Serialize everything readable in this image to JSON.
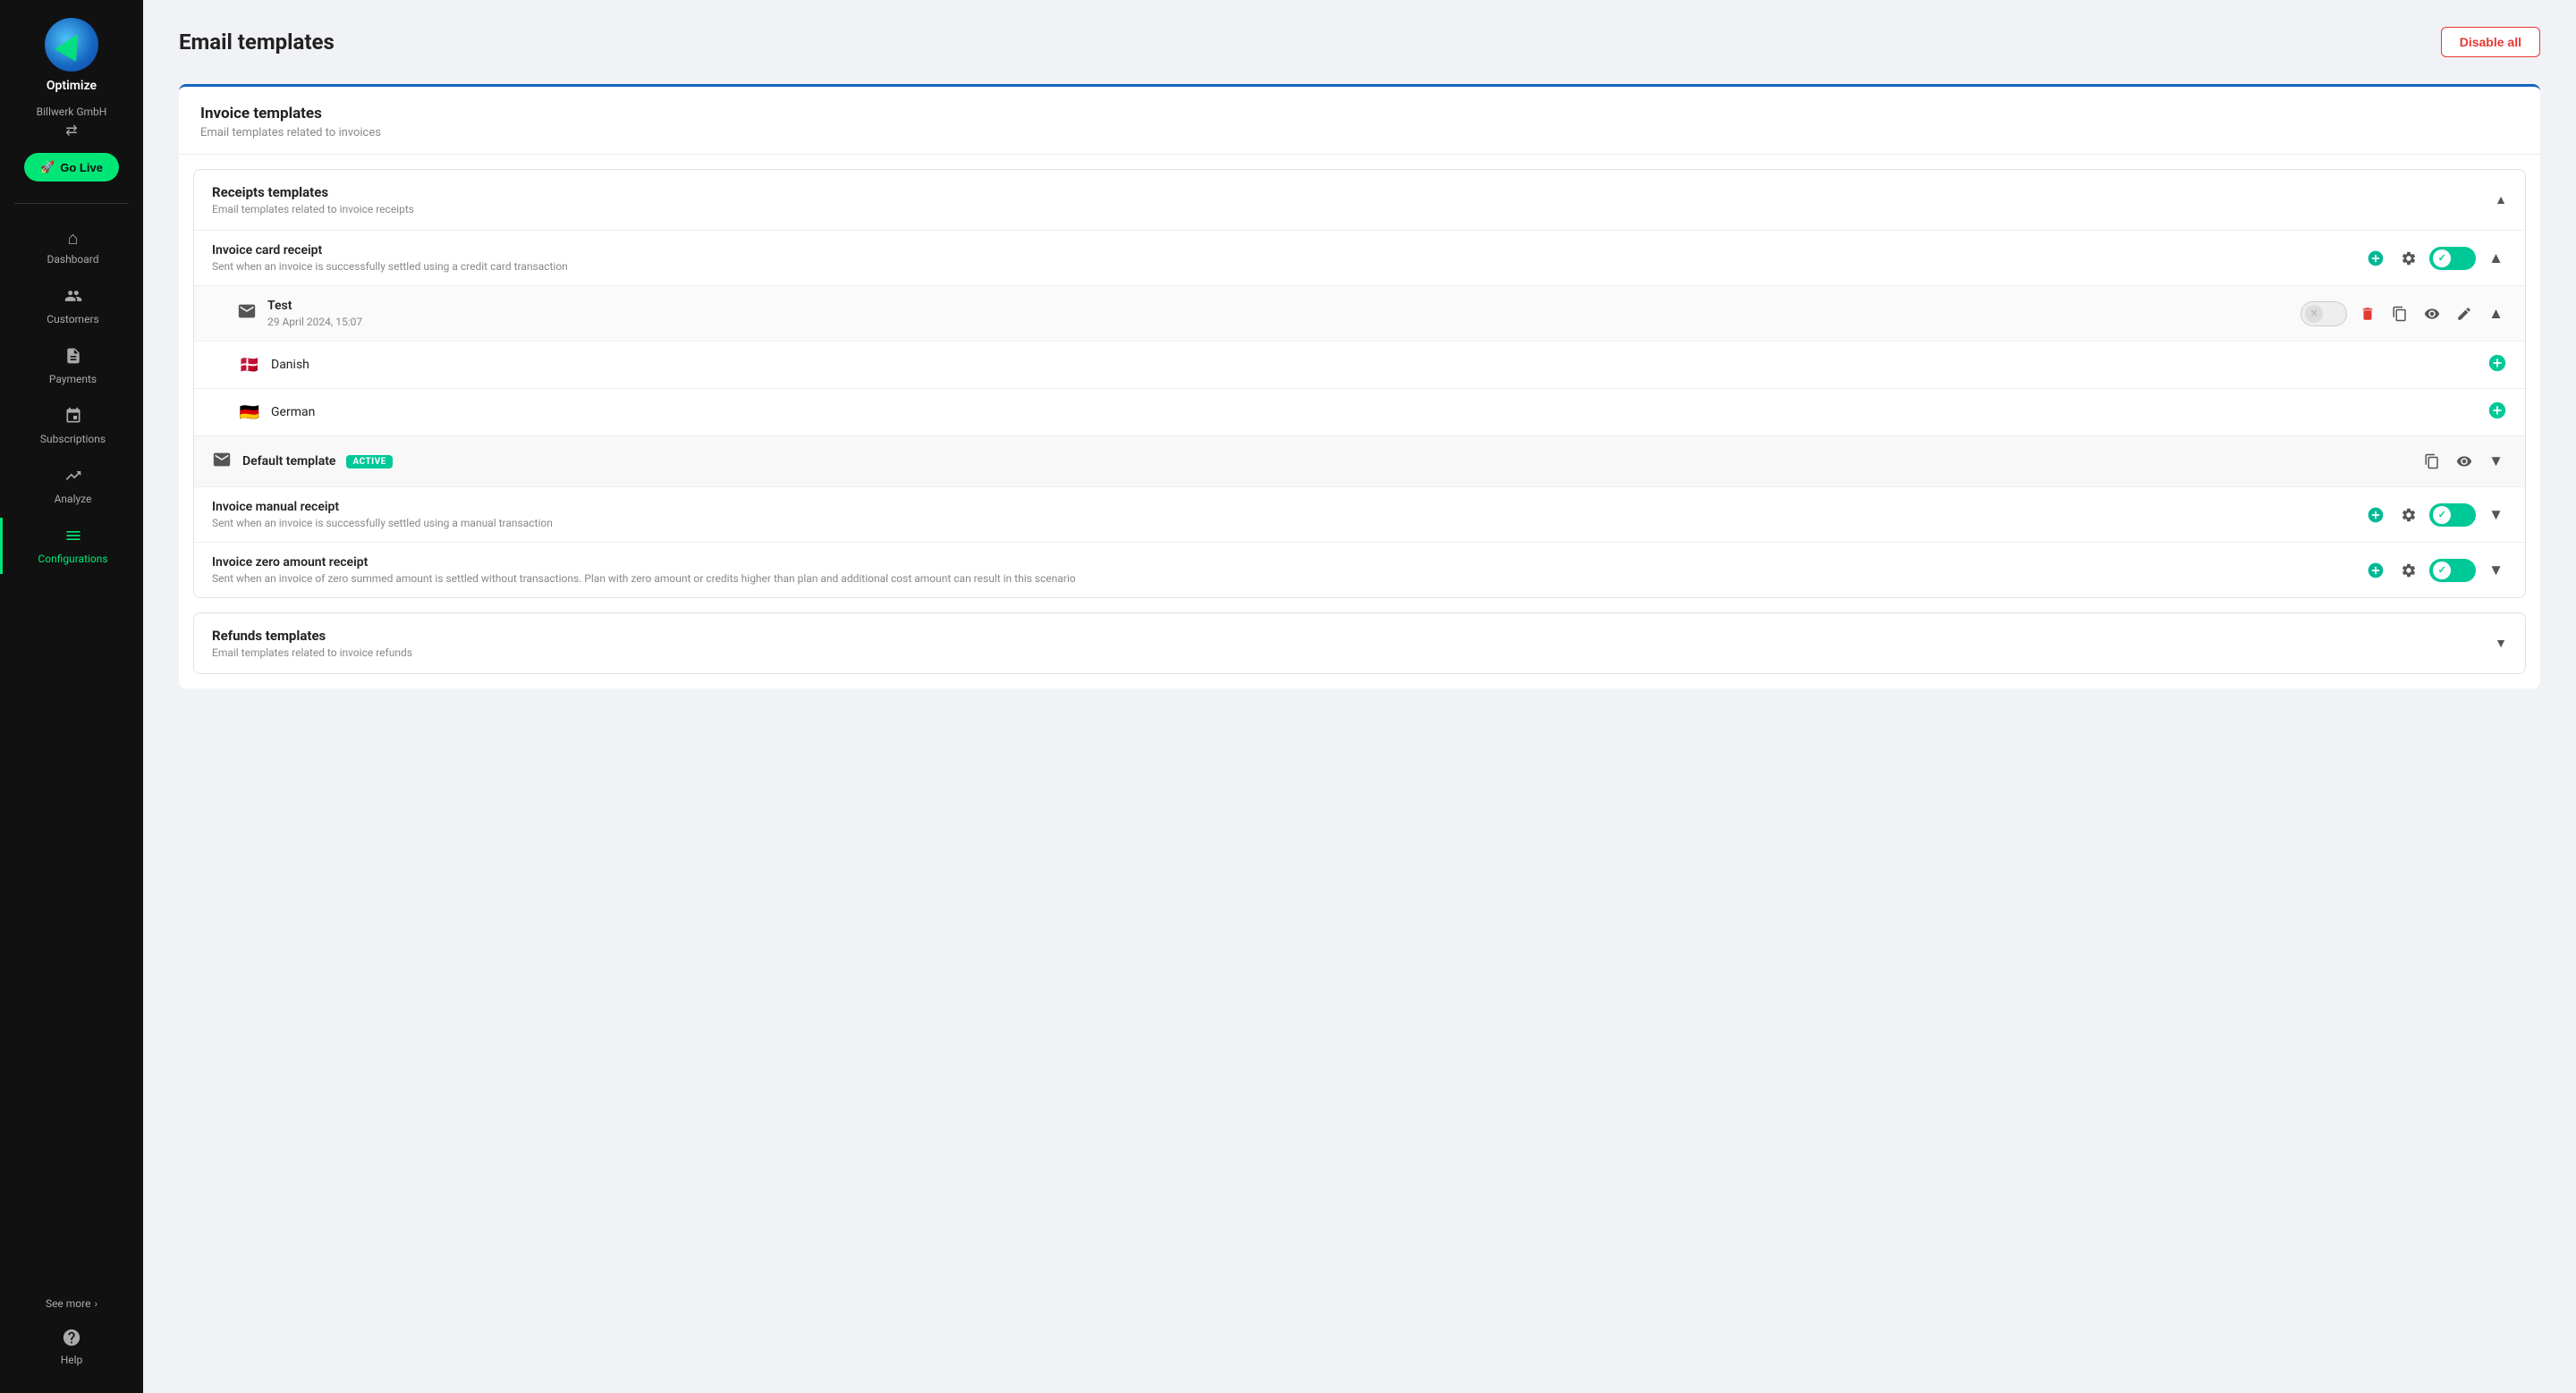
{
  "app": {
    "name": "Optimize",
    "company": "Billwerk GmbH"
  },
  "sidebar": {
    "go_live_label": "Go Live",
    "items": [
      {
        "id": "dashboard",
        "label": "Dashboard",
        "icon": "⌂",
        "active": false
      },
      {
        "id": "customers",
        "label": "Customers",
        "icon": "👥",
        "active": false
      },
      {
        "id": "payments",
        "label": "Payments",
        "icon": "📄",
        "active": false
      },
      {
        "id": "subscriptions",
        "label": "Subscriptions",
        "icon": "📅",
        "active": false
      },
      {
        "id": "analyze",
        "label": "Analyze",
        "icon": "📈",
        "active": false
      },
      {
        "id": "configurations",
        "label": "Configurations",
        "icon": "≡",
        "active": true
      }
    ],
    "see_more_label": "See more",
    "help_label": "Help"
  },
  "header": {
    "title": "Email templates",
    "disable_all_label": "Disable all"
  },
  "section": {
    "title": "Invoice templates",
    "subtitle": "Email templates related to invoices",
    "groups": [
      {
        "id": "receipts",
        "title": "Receipts templates",
        "subtitle": "Email templates related to invoice receipts",
        "expanded": true,
        "templates": [
          {
            "id": "card-receipt",
            "title": "Invoice card receipt",
            "subtitle": "Sent when an invoice is successfully settled using a credit card transaction",
            "toggle_on": true,
            "has_sub": true,
            "sub_items": [
              {
                "id": "test-template",
                "title": "Test",
                "date": "29 April 2024, 15:07",
                "toggle_on": false,
                "languages": [
                  {
                    "id": "danish",
                    "name": "Danish",
                    "flag": "🇩🇰"
                  },
                  {
                    "id": "german",
                    "name": "German",
                    "flag": "🇩🇪"
                  }
                ],
                "has_default": true
              }
            ]
          },
          {
            "id": "manual-receipt",
            "title": "Invoice manual receipt",
            "subtitle": "Sent when an invoice is successfully settled using a manual transaction",
            "toggle_on": true
          },
          {
            "id": "zero-receipt",
            "title": "Invoice zero amount receipt",
            "subtitle": "Sent when an invoice of zero summed amount is settled without transactions. Plan with zero amount or credits higher than plan and additional cost amount can result in this scenario",
            "toggle_on": true
          }
        ]
      },
      {
        "id": "refunds",
        "title": "Refunds templates",
        "subtitle": "Email templates related to invoice refunds",
        "expanded": false
      }
    ]
  }
}
